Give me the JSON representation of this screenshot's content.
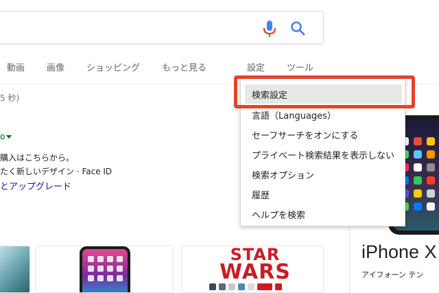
{
  "search": {
    "mic_icon": "microphone-icon",
    "search_icon": "search-icon",
    "accent_colors": {
      "mic_blue": "#4285f4",
      "mic_red": "#ea4335",
      "search_blue": "#4285f4"
    }
  },
  "tabs": {
    "video": "動画",
    "images": "画像",
    "shopping": "ショッピング",
    "more": "もっと見る",
    "settings": "設定",
    "tools": "ツール"
  },
  "results": {
    "stats_fragment": "5 秒)",
    "arrow_fragment": "o",
    "line1": "購入はこちらから。",
    "line2": "たく新しいデザイン · Face ID",
    "link": "とアップグレード"
  },
  "settings_menu": {
    "highlight_color": "#e8e8e8",
    "callout_color": "#e8412b",
    "items": [
      "検索設定",
      "言語（Languages）",
      "セーフサーチをオンにする",
      "プライベート検索結果を表示しない",
      "検索オプション",
      "履歴",
      "ヘルプを検索"
    ]
  },
  "knowledge_panel": {
    "title": "iPhone X",
    "subtitle": "アイフォーン テン"
  },
  "thumbnails": {
    "starwars_line1": "STAR",
    "starwars_line2": "WARS"
  }
}
